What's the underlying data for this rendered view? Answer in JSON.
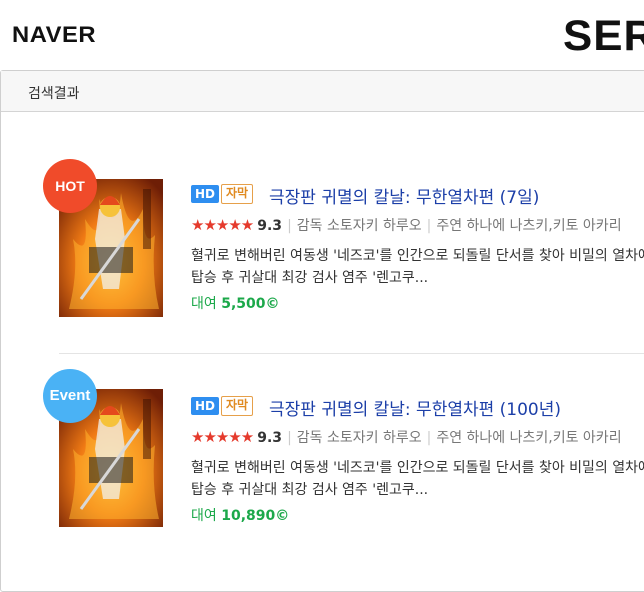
{
  "header": {
    "logo": "NAVER",
    "service_logo": "SER"
  },
  "panel": {
    "title": "검색결과"
  },
  "items": [
    {
      "badge": "HOT",
      "tag_hd": "HD",
      "tag_sub": "자막",
      "title": "극장판 귀멸의 칼날: 무한열차편 (7일)",
      "stars": "★★★★★",
      "rating": "9.3",
      "director": "감독 소토자키 하루오",
      "cast": "주연 하나에 나츠키,키토 아카리",
      "desc_line1": "혈귀로 변해버린 여동생 '네즈코'를 인간으로 되돌릴 단서를 찾아 비밀의 열차에",
      "desc_line2": "탑승 후 귀살대 최강 검사 염주 '렌고쿠...",
      "price_label": "대여",
      "price": "5,500",
      "coin_icon": "©"
    },
    {
      "badge": "Event",
      "tag_hd": "HD",
      "tag_sub": "자막",
      "title": "극장판 귀멸의 칼날: 무한열차편 (100년)",
      "stars": "★★★★★",
      "rating": "9.3",
      "director": "감독 소토자키 하루오",
      "cast": "주연 하나에 나츠키,키토 아카리",
      "desc_line1": "혈귀로 변해버린 여동생 '네즈코'를 인간으로 되돌릴 단서를 찾아 비밀의 열차에",
      "desc_line2": "탑승 후 귀살대 최강 검사 염주 '렌고쿠...",
      "price_label": "대여",
      "price": "10,890",
      "coin_icon": "©"
    }
  ]
}
